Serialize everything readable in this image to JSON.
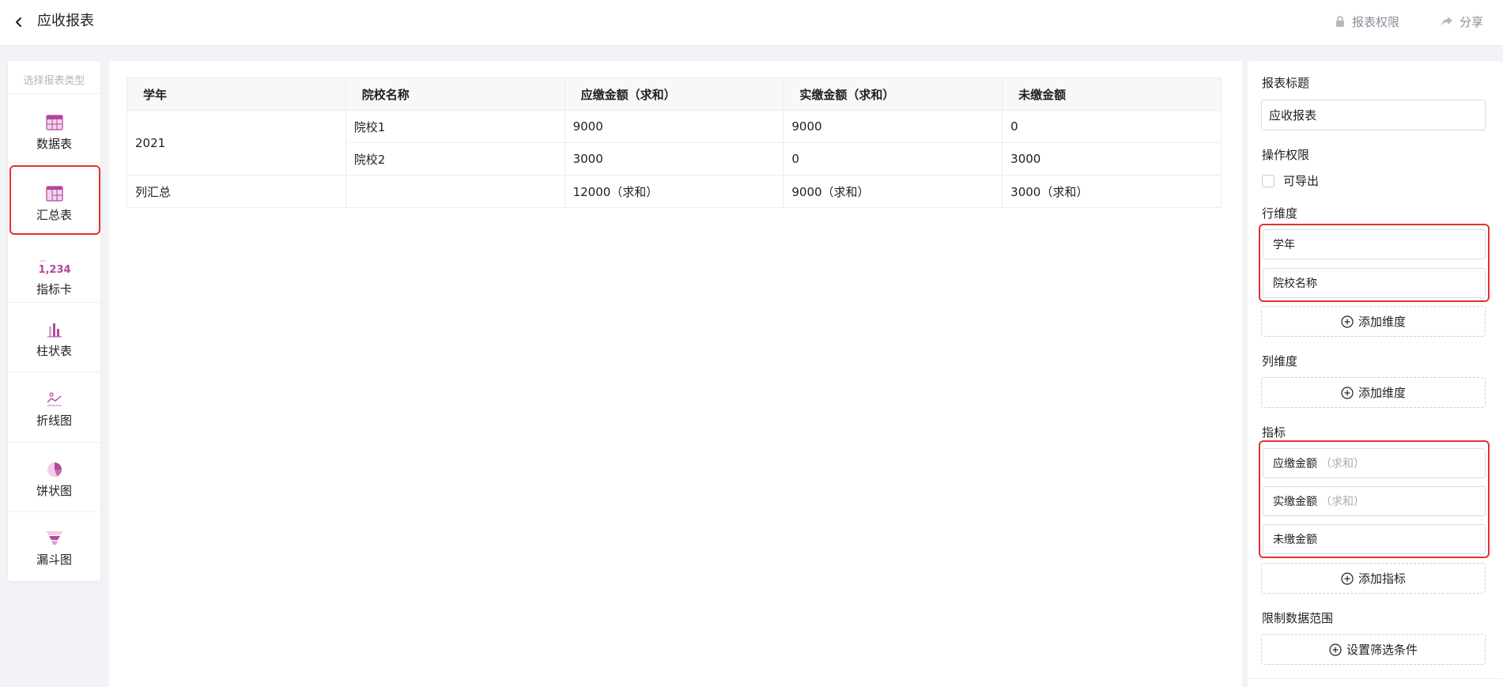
{
  "header": {
    "title": "应收报表",
    "permission_label": "报表权限",
    "share_label": "分享"
  },
  "left_panel": {
    "title": "选择报表类型",
    "items": [
      {
        "label": "数据表",
        "icon": "table-grid-icon"
      },
      {
        "label": "汇总表",
        "icon": "summary-table-icon",
        "selected": true
      },
      {
        "label": "指标卡",
        "icon": "metric-card-icon",
        "icon_text": "1,234"
      },
      {
        "label": "柱状表",
        "icon": "bar-chart-icon"
      },
      {
        "label": "折线图",
        "icon": "line-chart-icon"
      },
      {
        "label": "饼状图",
        "icon": "pie-chart-icon"
      },
      {
        "label": "漏斗图",
        "icon": "funnel-chart-icon"
      }
    ]
  },
  "table": {
    "headers": [
      "学年",
      "院校名称",
      "应缴金额（求和）",
      "实缴金额（求和）",
      "未缴金额"
    ],
    "group_year": "2021",
    "rows": [
      {
        "school": "院校1",
        "due": "9000",
        "paid": "9000",
        "unpaid": "0"
      },
      {
        "school": "院校2",
        "due": "3000",
        "paid": "0",
        "unpaid": "3000"
      }
    ],
    "total": {
      "label": "列汇总",
      "school": "",
      "due": "12000（求和）",
      "paid": "9000（求和）",
      "unpaid": "3000（求和）"
    }
  },
  "config": {
    "title_label": "报表标题",
    "title_value": "应收报表",
    "perm_label": "操作权限",
    "export_label": "可导出",
    "row_dim_label": "行维度",
    "row_dims": [
      "学年",
      "院校名称"
    ],
    "add_dim_label": "添加维度",
    "col_dim_label": "列维度",
    "metric_label": "指标",
    "metrics": [
      {
        "name": "应缴金额",
        "agg": "（求和）"
      },
      {
        "name": "实缴金额",
        "agg": "（求和）"
      },
      {
        "name": "未缴金额",
        "agg": ""
      }
    ],
    "add_metric_label": "添加指标",
    "range_label": "限制数据范围",
    "filter_label": "设置筛选条件"
  },
  "colors": {
    "accent_purple": "#b3479e",
    "highlight_red": "#e3322e"
  }
}
